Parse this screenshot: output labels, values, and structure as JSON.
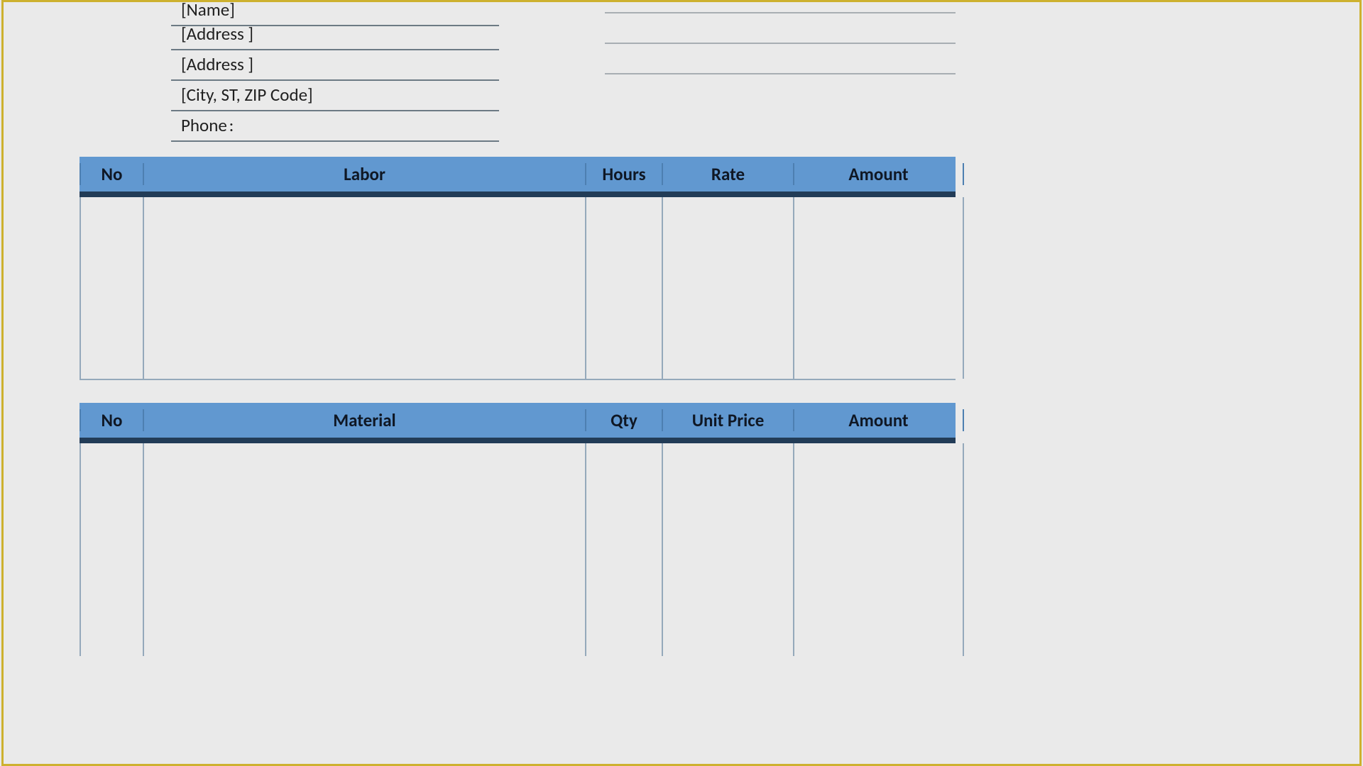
{
  "info": {
    "name": "[Name]",
    "address1": "[Address ]",
    "address2": "[Address ]",
    "city": "[City, ST, ZIP Code]",
    "phoneLabel": "Phone",
    "phoneColon": ":"
  },
  "laborTable": {
    "headers": {
      "no": "No",
      "desc": "Labor",
      "qty": "Hours",
      "rate": "Rate",
      "amt": "Amount"
    }
  },
  "materialTable": {
    "headers": {
      "no": "No",
      "desc": "Material",
      "qty": "Qty",
      "rate": "Unit Price",
      "amt": "Amount"
    }
  },
  "colors": {
    "headerBg": "#6198d0",
    "headerUnderline": "#223c57",
    "gridLine": "#95a9bb",
    "frame": "#cdb12f"
  }
}
